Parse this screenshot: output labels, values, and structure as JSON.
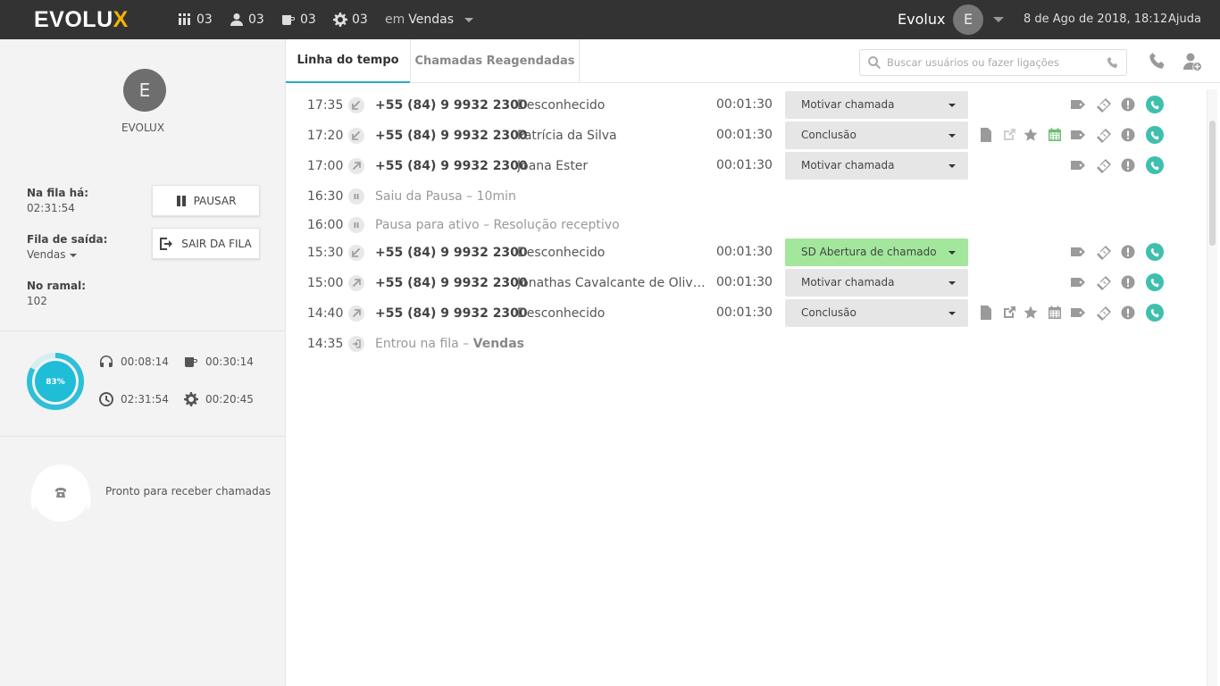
{
  "topbar": {
    "logo_main": "EVOLU",
    "logo_x": "X",
    "stats": [
      {
        "icon": "queue-users-icon",
        "value": "03"
      },
      {
        "icon": "user-icon",
        "value": "03"
      },
      {
        "icon": "coffee-icon",
        "value": "03"
      },
      {
        "icon": "gear-icon",
        "value": "03"
      }
    ],
    "queue_prefix": "em",
    "queue_name": "Vendas",
    "user_name": "Evolux",
    "user_initial": "E",
    "datetime": "8 de Ago de 2018, 18:12",
    "help": "Ajuda"
  },
  "sidebar": {
    "avatar_initial": "E",
    "agent_name": "EVOLUX",
    "in_queue_label": "Na fila há:",
    "in_queue_value": "02:31:54",
    "out_queue_label": "Fila de saída:",
    "out_queue_value": "Vendas",
    "extension_label": "No ramal:",
    "extension_value": "102",
    "pause_button": "PAUSAR",
    "leave_button": "SAIR DA FILA",
    "progress_label": "83%",
    "progress_value": 0.83,
    "metrics": {
      "talk_time": "00:08:14",
      "pause_time": "00:30:14",
      "total_time": "02:31:54",
      "other_time": "00:20:45"
    },
    "ready_text": "Pronto para receber chamadas"
  },
  "tabs": {
    "timeline": "Linha do tempo",
    "rescheduled": "Chamadas Reagendadas"
  },
  "search": {
    "placeholder": "Buscar usuários ou fazer ligações"
  },
  "timeline": [
    {
      "type": "call",
      "time": "17:35",
      "direction": "in",
      "phone": "+55 (84) 9 9932 2300",
      "name": "Desconhecido",
      "duration": "00:01:30",
      "disposition": "Motivar chamada",
      "green": false,
      "extra": "none"
    },
    {
      "type": "call",
      "time": "17:20",
      "direction": "in",
      "phone": "+55 (84) 9 9932 2300",
      "name": "Patrícia da Silva",
      "duration": "00:01:30",
      "disposition": "Conclusão",
      "green": false,
      "extra": "scheduled"
    },
    {
      "type": "call",
      "time": "17:00",
      "direction": "out",
      "phone": "+55 (84) 9 9932 2300",
      "name": "Joana Ester",
      "duration": "00:01:30",
      "disposition": "Motivar chamada",
      "green": false,
      "extra": "none"
    },
    {
      "type": "event",
      "time": "16:30",
      "icon": "pause-icon",
      "text": "Saiu da Pausa  – 10min",
      "bold": ""
    },
    {
      "type": "event",
      "time": "16:00",
      "icon": "pause-icon",
      "text": "Pausa para ativo – Resolução receptivo",
      "bold": ""
    },
    {
      "type": "call",
      "time": "15:30",
      "direction": "in",
      "phone": "+55 (84) 9 9932 2300",
      "name": "Desconhecido",
      "duration": "00:01:30",
      "disposition": "SD Abertura de chamado",
      "green": true,
      "extra": "none"
    },
    {
      "type": "call",
      "time": "15:00",
      "direction": "out",
      "phone": "+55 (84) 9 9932 2300",
      "name": "Jonathas Cavalcante de Oliveira Neto",
      "duration": "00:01:30",
      "disposition": "Motivar chamada",
      "green": false,
      "extra": "none"
    },
    {
      "type": "call",
      "time": "14:40",
      "direction": "out",
      "phone": "+55 (84) 9 9932 2300",
      "name": "Desconhecido",
      "duration": "00:01:30",
      "disposition": "Conclusão",
      "green": false,
      "extra": "full"
    },
    {
      "type": "event",
      "time": "14:35",
      "icon": "enter-queue-icon",
      "text": "Entrou na fila – ",
      "bold": "Vendas"
    }
  ]
}
